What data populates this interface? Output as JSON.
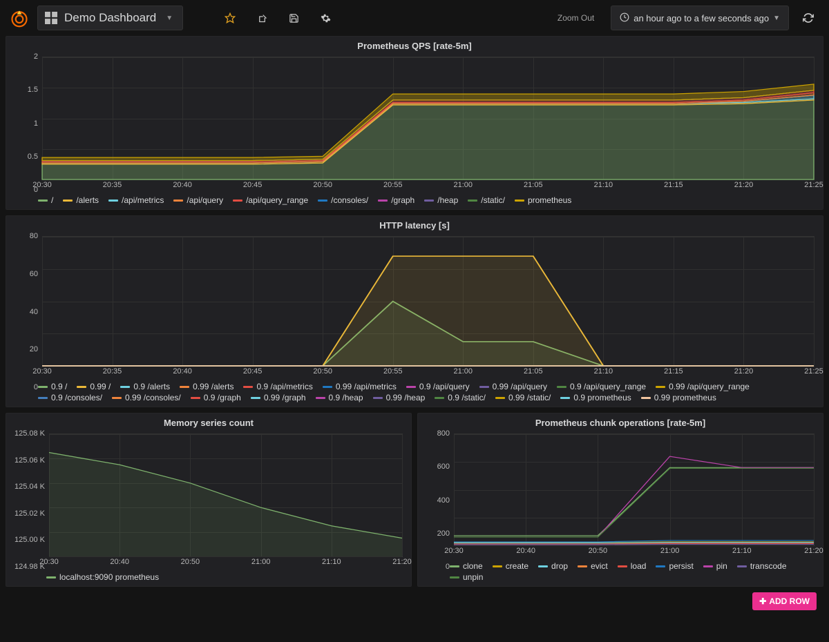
{
  "header": {
    "dashboard_name": "Demo Dashboard",
    "zoom_out": "Zoom Out",
    "time_range": "an hour ago to a few seconds ago"
  },
  "add_row_label": "ADD ROW",
  "colors": {
    "green": "#7eb26d",
    "yellow": "#eab839",
    "cyan": "#6ed0e0",
    "orange": "#ef843c",
    "red": "#e24d42",
    "blue": "#1f78c1",
    "purple": "#ba43a9",
    "violet": "#705da0",
    "dkgreen": "#508642",
    "dkyellow": "#cca300",
    "dkblue": "#447ebc",
    "salmon": "#f2c59f"
  },
  "chart_data": [
    {
      "id": "qps",
      "title": "Prometheus QPS [rate-5m]",
      "type": "area",
      "stacked": true,
      "ylim": [
        0,
        2.0
      ],
      "yticks": [
        0,
        0.5,
        1.0,
        1.5,
        2.0
      ],
      "x": [
        "20:30",
        "20:35",
        "20:40",
        "20:45",
        "20:50",
        "20:55",
        "21:00",
        "21:05",
        "21:10",
        "21:15",
        "21:20",
        "21:25"
      ],
      "series": [
        {
          "name": "/",
          "color": "green",
          "values": [
            0.25,
            0.25,
            0.25,
            0.25,
            0.27,
            1.22,
            1.22,
            1.22,
            1.22,
            1.22,
            1.24,
            1.3
          ]
        },
        {
          "name": "/alerts",
          "color": "yellow",
          "values": [
            0.02,
            0.02,
            0.02,
            0.02,
            0.02,
            0.02,
            0.02,
            0.02,
            0.02,
            0.02,
            0.02,
            0.02
          ]
        },
        {
          "name": "/api/metrics",
          "color": "cyan",
          "values": [
            0.0,
            0.0,
            0.0,
            0.0,
            0.0,
            0.0,
            0.0,
            0.0,
            0.0,
            0.0,
            0.02,
            0.06
          ]
        },
        {
          "name": "/api/query",
          "color": "orange",
          "values": [
            0.02,
            0.02,
            0.02,
            0.02,
            0.02,
            0.02,
            0.02,
            0.02,
            0.02,
            0.02,
            0.02,
            0.04
          ]
        },
        {
          "name": "/api/query_range",
          "color": "red",
          "values": [
            0.02,
            0.02,
            0.02,
            0.02,
            0.02,
            0.04,
            0.04,
            0.04,
            0.04,
            0.04,
            0.04,
            0.04
          ]
        },
        {
          "name": "/consoles/",
          "color": "blue",
          "values": [
            0.0,
            0.0,
            0.0,
            0.0,
            0.0,
            0.0,
            0.0,
            0.0,
            0.0,
            0.0,
            0.0,
            0.0
          ]
        },
        {
          "name": "/graph",
          "color": "purple",
          "values": [
            0.0,
            0.0,
            0.0,
            0.0,
            0.0,
            0.0,
            0.0,
            0.0,
            0.0,
            0.0,
            0.0,
            0.0
          ]
        },
        {
          "name": "/heap",
          "color": "violet",
          "values": [
            0.0,
            0.0,
            0.0,
            0.0,
            0.0,
            0.0,
            0.0,
            0.0,
            0.0,
            0.0,
            0.0,
            0.0
          ]
        },
        {
          "name": "/static/",
          "color": "dkgreen",
          "values": [
            0.0,
            0.0,
            0.0,
            0.0,
            0.0,
            0.0,
            0.0,
            0.0,
            0.0,
            0.0,
            0.0,
            0.0
          ]
        },
        {
          "name": "prometheus",
          "color": "dkyellow",
          "values": [
            0.05,
            0.05,
            0.05,
            0.05,
            0.05,
            0.1,
            0.1,
            0.1,
            0.1,
            0.1,
            0.1,
            0.1
          ]
        }
      ]
    },
    {
      "id": "latency",
      "title": "HTTP latency [s]",
      "type": "line",
      "ylim": [
        0,
        80
      ],
      "yticks": [
        0,
        20,
        40,
        60,
        80
      ],
      "x": [
        "20:30",
        "20:35",
        "20:40",
        "20:45",
        "20:50",
        "20:55",
        "21:00",
        "21:05",
        "21:10",
        "21:15",
        "21:20",
        "21:25"
      ],
      "series": [
        {
          "name": "0.9 /",
          "color": "green",
          "values": [
            0,
            0,
            0,
            0,
            0,
            40,
            15,
            15,
            0,
            0,
            0,
            0
          ]
        },
        {
          "name": "0.99 /",
          "color": "yellow",
          "values": [
            0,
            0,
            0,
            0,
            0,
            68,
            68,
            68,
            0,
            0,
            0,
            0
          ]
        },
        {
          "name": "0.9 /alerts",
          "color": "cyan",
          "values": [
            0,
            0,
            0,
            0,
            0,
            0,
            0,
            0,
            0,
            0,
            0,
            0
          ]
        },
        {
          "name": "0.99 /alerts",
          "color": "orange",
          "values": [
            0,
            0,
            0,
            0,
            0,
            0,
            0,
            0,
            0,
            0,
            0,
            0
          ]
        },
        {
          "name": "0.9 /api/metrics",
          "color": "red",
          "values": [
            0,
            0,
            0,
            0,
            0,
            0,
            0,
            0,
            0,
            0,
            0,
            0
          ]
        },
        {
          "name": "0.99 /api/metrics",
          "color": "blue",
          "values": [
            0,
            0,
            0,
            0,
            0,
            0,
            0,
            0,
            0,
            0,
            0,
            0
          ]
        },
        {
          "name": "0.9 /api/query",
          "color": "purple",
          "values": [
            0,
            0,
            0,
            0,
            0,
            0,
            0,
            0,
            0,
            0,
            0,
            0
          ]
        },
        {
          "name": "0.99 /api/query",
          "color": "violet",
          "values": [
            0,
            0,
            0,
            0,
            0,
            0,
            0,
            0,
            0,
            0,
            0,
            0
          ]
        },
        {
          "name": "0.9 /api/query_range",
          "color": "dkgreen",
          "values": [
            0,
            0,
            0,
            0,
            0,
            0,
            0,
            0,
            0,
            0,
            0,
            0
          ]
        },
        {
          "name": "0.99 /api/query_range",
          "color": "dkyellow",
          "values": [
            0,
            0,
            0,
            0,
            0,
            0,
            0,
            0,
            0,
            0,
            0,
            0
          ]
        },
        {
          "name": "0.9 /consoles/",
          "color": "dkblue",
          "values": [
            0,
            0,
            0,
            0,
            0,
            0,
            0,
            0,
            0,
            0,
            0,
            0
          ]
        },
        {
          "name": "0.99 /consoles/",
          "color": "orange",
          "values": [
            0,
            0,
            0,
            0,
            0,
            0,
            0,
            0,
            0,
            0,
            0,
            0
          ]
        },
        {
          "name": "0.9 /graph",
          "color": "red",
          "values": [
            0,
            0,
            0,
            0,
            0,
            0,
            0,
            0,
            0,
            0,
            0,
            0
          ]
        },
        {
          "name": "0.99 /graph",
          "color": "cyan",
          "values": [
            0,
            0,
            0,
            0,
            0,
            0,
            0,
            0,
            0,
            0,
            0,
            0
          ]
        },
        {
          "name": "0.9 /heap",
          "color": "purple",
          "values": [
            0,
            0,
            0,
            0,
            0,
            0,
            0,
            0,
            0,
            0,
            0,
            0
          ]
        },
        {
          "name": "0.99 /heap",
          "color": "violet",
          "values": [
            0,
            0,
            0,
            0,
            0,
            0,
            0,
            0,
            0,
            0,
            0,
            0
          ]
        },
        {
          "name": "0.9 /static/",
          "color": "dkgreen",
          "values": [
            0,
            0,
            0,
            0,
            0,
            0,
            0,
            0,
            0,
            0,
            0,
            0
          ]
        },
        {
          "name": "0.99 /static/",
          "color": "dkyellow",
          "values": [
            0,
            0,
            0,
            0,
            0,
            0,
            0,
            0,
            0,
            0,
            0,
            0
          ]
        },
        {
          "name": "0.9 prometheus",
          "color": "cyan",
          "values": [
            0,
            0,
            0,
            0,
            0,
            0,
            0,
            0,
            0,
            0,
            0,
            0
          ]
        },
        {
          "name": "0.99 prometheus",
          "color": "salmon",
          "values": [
            0,
            0,
            0,
            0,
            0,
            0,
            0,
            0,
            0,
            0,
            0,
            0
          ]
        }
      ]
    },
    {
      "id": "memseries",
      "title": "Memory series count",
      "type": "line",
      "ylim": [
        124980,
        125080
      ],
      "yticks_fmt": [
        "124.98 K",
        "125.00 K",
        "125.02 K",
        "125.04 K",
        "125.06 K",
        "125.08 K"
      ],
      "yticks": [
        124980,
        125000,
        125020,
        125040,
        125060,
        125080
      ],
      "x": [
        "20:30",
        "20:40",
        "20:50",
        "21:00",
        "21:10",
        "21:20"
      ],
      "series": [
        {
          "name": "localhost:9090 prometheus",
          "color": "green",
          "values": [
            125065,
            125055,
            125040,
            125020,
            125005,
            124995
          ]
        }
      ]
    },
    {
      "id": "chunks",
      "title": "Prometheus chunk operations [rate-5m]",
      "type": "line",
      "ylim": [
        0,
        800
      ],
      "yticks": [
        0,
        200,
        400,
        600,
        800
      ],
      "x": [
        "20:30",
        "20:40",
        "20:50",
        "21:00",
        "21:10",
        "21:20"
      ],
      "series": [
        {
          "name": "clone",
          "color": "green",
          "values": [
            70,
            70,
            70,
            560,
            560,
            560
          ]
        },
        {
          "name": "create",
          "color": "dkyellow",
          "values": [
            20,
            20,
            20,
            25,
            25,
            25
          ]
        },
        {
          "name": "drop",
          "color": "cyan",
          "values": [
            18,
            18,
            18,
            22,
            22,
            22
          ]
        },
        {
          "name": "evict",
          "color": "orange",
          "values": [
            10,
            10,
            10,
            15,
            15,
            15
          ]
        },
        {
          "name": "load",
          "color": "red",
          "values": [
            8,
            8,
            8,
            12,
            12,
            12
          ]
        },
        {
          "name": "persist",
          "color": "blue",
          "values": [
            25,
            25,
            25,
            35,
            35,
            35
          ]
        },
        {
          "name": "pin",
          "color": "purple",
          "values": [
            60,
            60,
            60,
            640,
            560,
            560
          ]
        },
        {
          "name": "transcode",
          "color": "violet",
          "values": [
            5,
            5,
            5,
            8,
            8,
            8
          ]
        },
        {
          "name": "unpin",
          "color": "dkgreen",
          "values": [
            60,
            60,
            60,
            555,
            555,
            555
          ]
        }
      ]
    }
  ]
}
